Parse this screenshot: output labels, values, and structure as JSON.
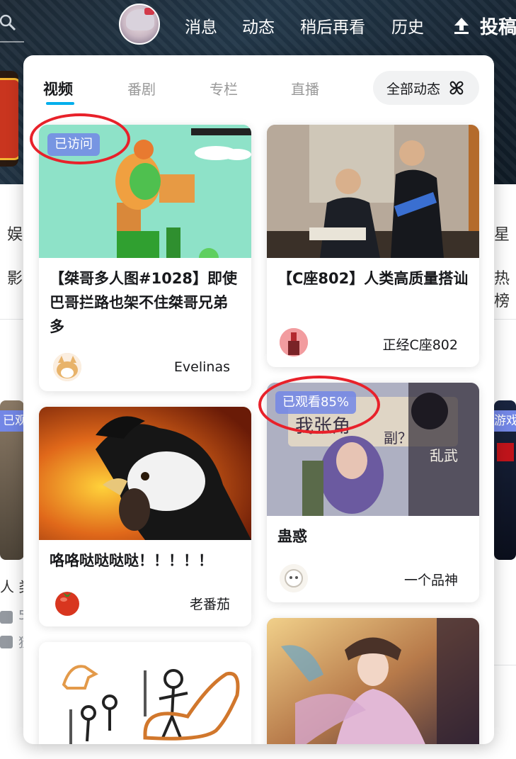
{
  "header": {
    "nav": [
      "消息",
      "动态",
      "稍后再看",
      "历史"
    ],
    "upload_label": "投稿"
  },
  "background": {
    "left_texts": [
      "娱",
      "影"
    ],
    "right_texts": [
      "星",
      "热榜"
    ],
    "left_partial": [
      "人 类",
      "5",
      "猹"
    ],
    "left_badge": "已观",
    "right_badge": "游戏"
  },
  "popup": {
    "tabs": [
      "视频",
      "番剧",
      "专栏",
      "直播"
    ],
    "active_tab": "视频",
    "all_button": "全部动态",
    "cards": [
      {
        "title": "【桀哥多人图#1028】即使巴哥拦路也架不住桀哥兄弟多",
        "author": "Evelinas",
        "badge": "已访问"
      },
      {
        "title": "【C座802】人类高质量搭讪",
        "author": "正经C座802"
      },
      {
        "title": "咯咯哒哒哒哒！！！！！",
        "author": "老番茄"
      },
      {
        "title": "蛊惑",
        "author": "一个品神",
        "badge": "已观看85%"
      }
    ]
  },
  "colors": {
    "accent": "#00aeec",
    "badge_bg": "#7387e6",
    "highlight_ring": "#e8212a"
  }
}
